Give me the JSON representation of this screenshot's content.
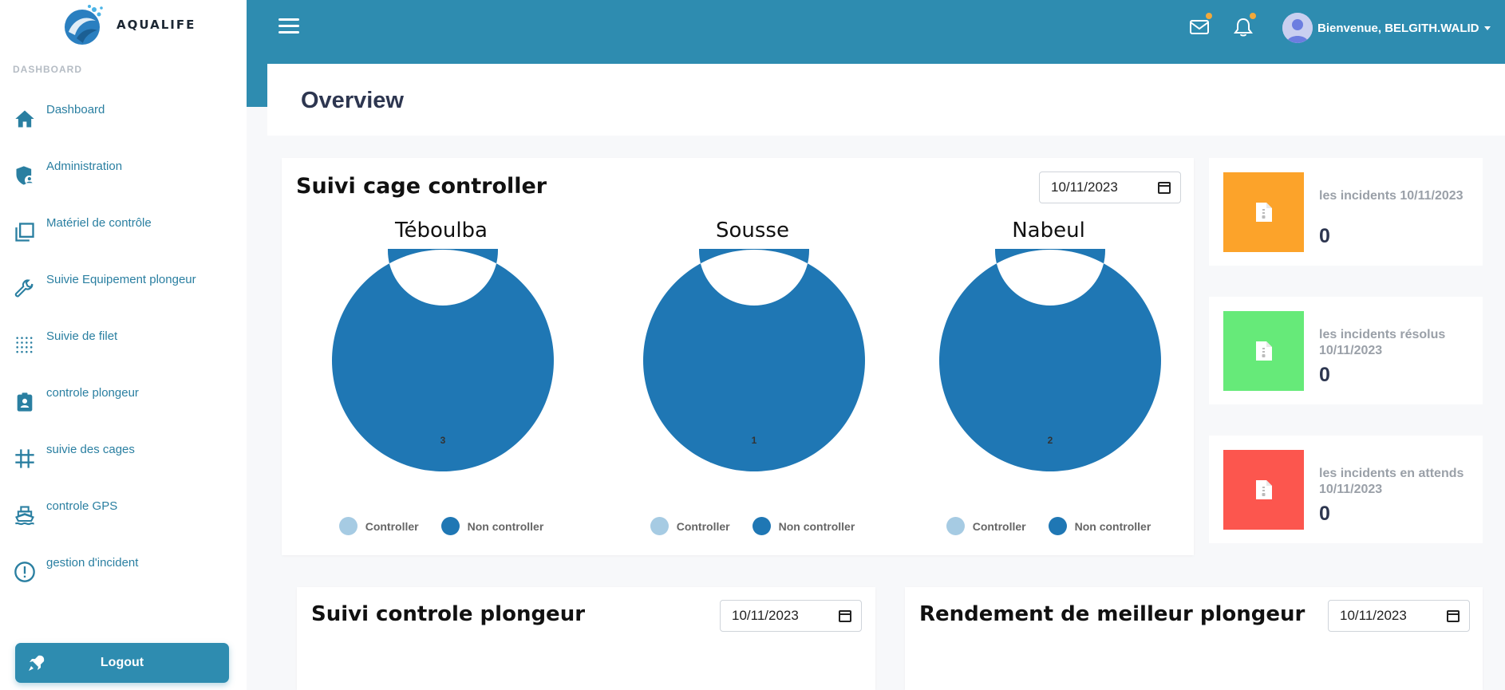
{
  "brand": {
    "name": "AQUALIFE"
  },
  "sidebar": {
    "section_label": "DASHBOARD",
    "items": [
      {
        "label": "Dashboard",
        "icon": "home-icon"
      },
      {
        "label": "Administration",
        "icon": "shield-user-icon"
      },
      {
        "label": "Matériel de contrôle",
        "icon": "copy-icon"
      },
      {
        "label": "Suivie Equipement plongeur",
        "icon": "wrench-icon"
      },
      {
        "label": "Suivie de filet",
        "icon": "net-grid-icon"
      },
      {
        "label": "controle plongeur",
        "icon": "badge-icon"
      },
      {
        "label": "suivie des cages",
        "icon": "hash-grid-icon"
      },
      {
        "label": "controle GPS",
        "icon": "ship-icon"
      },
      {
        "label": "gestion d'incident",
        "icon": "alert-circle-icon"
      }
    ],
    "logout_label": "Logout"
  },
  "topbar": {
    "welcome": "Bienvenue, BELGITH.WALID",
    "accent": "#2e8cb0",
    "badge_color": "#f2a93b"
  },
  "page": {
    "title": "Overview"
  },
  "cage_card": {
    "title": "Suivi cage controller",
    "date": "10/11/2023"
  },
  "chart_data": [
    {
      "type": "pie",
      "title": "Téboulba",
      "categories": [
        "Controller",
        "Non controller"
      ],
      "values": [
        0,
        3
      ],
      "colors": [
        "#a6cbe3",
        "#1f77b4"
      ],
      "data_labels": [
        "",
        "3"
      ]
    },
    {
      "type": "pie",
      "title": "Sousse",
      "categories": [
        "Controller",
        "Non controller"
      ],
      "values": [
        0,
        1
      ],
      "colors": [
        "#a6cbe3",
        "#1f77b4"
      ],
      "data_labels": [
        "",
        "1"
      ]
    },
    {
      "type": "pie",
      "title": "Nabeul",
      "categories": [
        "Controller",
        "Non controller"
      ],
      "values": [
        0,
        2
      ],
      "colors": [
        "#a6cbe3",
        "#1f77b4"
      ],
      "data_labels": [
        "",
        "2"
      ]
    }
  ],
  "stats": [
    {
      "label": "les incidents 10/11/2023",
      "value": "0",
      "color": "#fca32a",
      "icon": "file-zip-icon"
    },
    {
      "label": "les incidents résolus 10/11/2023",
      "value": "0",
      "color": "#66ea79",
      "icon": "file-zip-icon"
    },
    {
      "label": "les incidents en attends 10/11/2023",
      "value": "0",
      "color": "#fc564e",
      "icon": "file-zip-icon"
    }
  ],
  "diver_card": {
    "title": "Suivi controle plongeur",
    "date": "10/11/2023"
  },
  "best_card": {
    "title": "Rendement de meilleur plongeur",
    "date": "10/11/2023"
  }
}
